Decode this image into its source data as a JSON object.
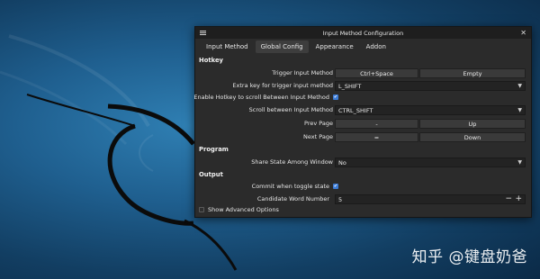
{
  "window": {
    "title": "Input Method Configuration"
  },
  "tabs": [
    {
      "label": "Input Method",
      "active": false
    },
    {
      "label": "Global Config",
      "active": true
    },
    {
      "label": "Appearance",
      "active": false
    },
    {
      "label": "Addon",
      "active": false
    }
  ],
  "hotkey": {
    "header": "Hotkey",
    "trigger": {
      "label": "Trigger Input Method",
      "key1": "Ctrl+Space",
      "key2": "Empty"
    },
    "extra_key": {
      "label": "Extra key for trigger input method",
      "value": "L_SHIFT"
    },
    "enable_scroll": {
      "label": "Enable Hotkey to scroll Between Input Method",
      "checked": true
    },
    "scroll_between": {
      "label": "Scroll between Input Method",
      "value": "CTRL_SHIFT"
    },
    "prev_page": {
      "label": "Prev Page",
      "key1": "-",
      "key2": "Up"
    },
    "next_page": {
      "label": "Next Page",
      "key1": "=",
      "key2": "Down"
    }
  },
  "program": {
    "header": "Program",
    "share_state": {
      "label": "Share State Among Window",
      "value": "No"
    }
  },
  "output": {
    "header": "Output",
    "commit_toggle": {
      "label": "Commit when toggle state",
      "checked": true
    },
    "candidate_number": {
      "label": "Candidate Word Number",
      "value": "5",
      "minus": "−",
      "plus": "+"
    }
  },
  "show_advanced": {
    "label": "Show Advanced Options",
    "checked": false
  },
  "watermark": "知乎 @键盘奶爸",
  "icons": {
    "dropdown": "chevron-down-icon",
    "check": "check-icon",
    "close": "close-icon",
    "menu": "menu-icon"
  }
}
